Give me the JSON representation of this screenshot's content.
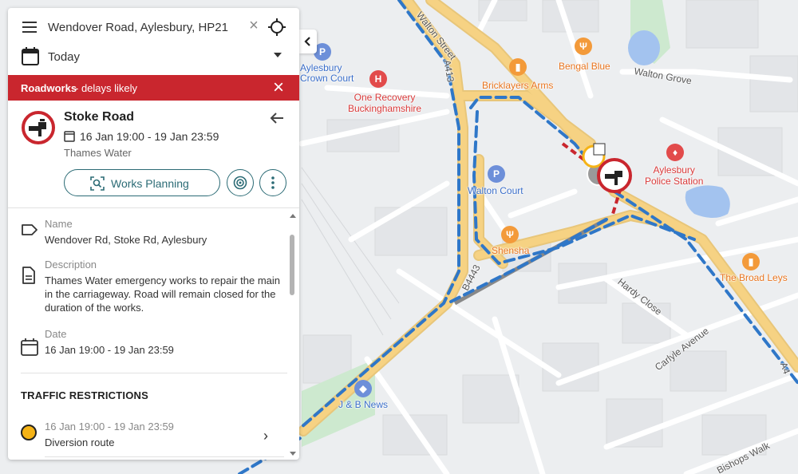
{
  "search": {
    "value": "Wendover Road, Aylesbury, HP21",
    "clear_icon": "close-icon",
    "locate_icon": "crosshair-icon"
  },
  "date_filter": {
    "label": "Today"
  },
  "alert": {
    "bold": "Roadworks",
    "rest": " - delays likely",
    "color": "#c9262e"
  },
  "event": {
    "title": "Stoke Road",
    "dates": "16 Jan 19:00 - 19 Jan 23:59",
    "organisation": "Thames Water",
    "icon": "tap-roadworks-icon",
    "works_planning_label": "Works Planning"
  },
  "details": {
    "name_label": "Name",
    "name_value": "Wendover Rd, Stoke Rd, Aylesbury",
    "description_label": "Description",
    "description_value": "Thames Water emergency works to repair the main in the carriageway. Road will remain closed for the duration of the works.",
    "date_label": "Date",
    "date_value": "16 Jan 19:00 - 19 Jan 23:59"
  },
  "traffic_restrictions": {
    "title": "TRAFFIC RESTRICTIONS",
    "items": [
      {
        "date": "16 Jan 19:00 - 19 Jan 23:59",
        "label": "Diversion route"
      }
    ]
  },
  "map": {
    "labels": {
      "aylesbury_crown_court": [
        "Aylesbury",
        "Crown Court"
      ],
      "one_recovery": [
        "One Recovery",
        "Buckinghamshire"
      ],
      "bricklayers_arms": "Bricklayers Arms",
      "bengal_blue": "Bengal Blue",
      "walton_grove": "Walton Grove",
      "walton_street": "Walton Street",
      "a413_north": "A413",
      "walton_court": "Walton Court",
      "aylesbury_police": [
        "Aylesbury",
        "Police Station"
      ],
      "shensha": "Shensha",
      "b4443": "B4443",
      "the_broad_leys": "The Broad Leys",
      "hardy_close": "Hardy Close",
      "carlyle_avenue": "Carlyle Avenue",
      "a4_edge": "A4",
      "jb_news": "J & B News",
      "bishops_walk": "Bishops Walk"
    },
    "colors": {
      "diversion": "#2f77c8",
      "closure": "#c9262e",
      "main_road": "#f6d283",
      "water": "#a3c3ef",
      "park": "#cde9cf"
    }
  }
}
